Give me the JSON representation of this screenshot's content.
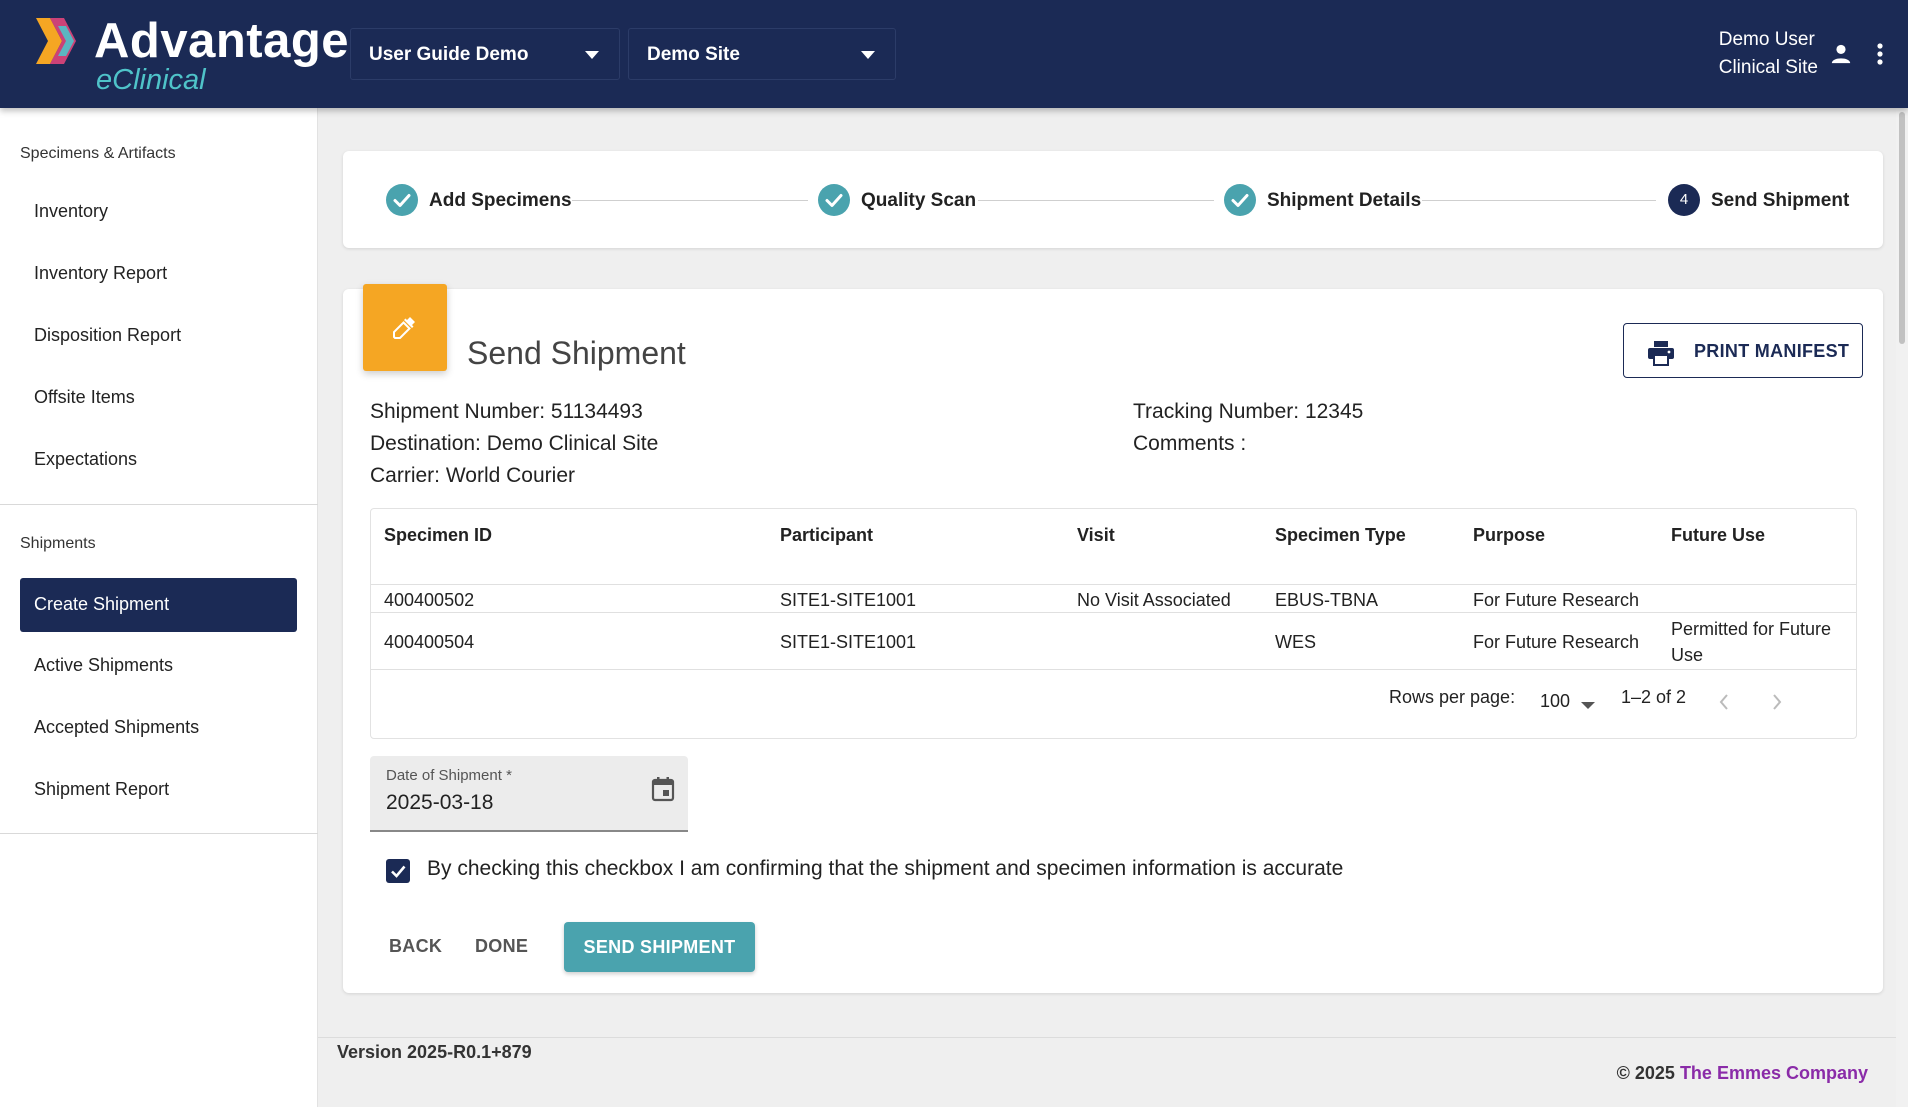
{
  "header": {
    "logo_title": "Advantage",
    "logo_subtitle": "eClinical",
    "study_selector": "User Guide Demo",
    "site_selector": "Demo Site",
    "user_name": "Demo User",
    "user_role": "Clinical Site"
  },
  "sidebar": {
    "section1": "Specimens & Artifacts",
    "section1_items": [
      "Inventory",
      "Inventory Report",
      "Disposition Report",
      "Offsite Items",
      "Expectations"
    ],
    "section2": "Shipments",
    "section2_items": [
      "Create Shipment",
      "Active Shipments",
      "Accepted Shipments",
      "Shipment Report"
    ],
    "active_item": "Create Shipment"
  },
  "stepper": {
    "steps": [
      {
        "label": "Add Specimens",
        "state": "complete"
      },
      {
        "label": "Quality Scan",
        "state": "complete"
      },
      {
        "label": "Shipment Details",
        "state": "complete"
      },
      {
        "label": "Send Shipment",
        "state": "active",
        "number": "4"
      }
    ]
  },
  "card": {
    "title": "Send Shipment",
    "print_button": "PRINT MANIFEST",
    "shipment_number": "Shipment Number: 51134493",
    "destination": "Destination: Demo Clinical Site",
    "carrier": "Carrier: World Courier",
    "tracking_number": "Tracking Number: 12345",
    "comments": "Comments :"
  },
  "table": {
    "headers": [
      "Specimen ID",
      "Participant",
      "Visit",
      "Specimen Type",
      "Purpose",
      "Future Use"
    ],
    "rows": [
      [
        "400400502",
        "SITE1-SITE1001",
        "No Visit Associated",
        "EBUS-TBNA",
        "For Future Research",
        ""
      ],
      [
        "400400504",
        "SITE1-SITE1001",
        "",
        "WES",
        "For Future Research",
        "Permitted for Future Use"
      ]
    ],
    "rows_per_page_label": "Rows per page:",
    "rows_per_page": "100",
    "range": "1–2 of 2"
  },
  "date_field": {
    "label": "Date of Shipment *",
    "value": "2025-03-18"
  },
  "confirm": {
    "checked": true,
    "label": "By checking this checkbox I am confirming that the shipment and specimen information is accurate"
  },
  "actions": {
    "back": "BACK",
    "done": "DONE",
    "send": "SEND SHIPMENT"
  },
  "footer": {
    "version": "Version 2025-R0.1+879",
    "copyright_prefix": "© 2025",
    "company": "The Emmes Company"
  },
  "colors": {
    "navy": "#1b2a55",
    "teal": "#4aa3ae",
    "orange": "#f5a623",
    "company_purple": "#8a2ba8"
  }
}
